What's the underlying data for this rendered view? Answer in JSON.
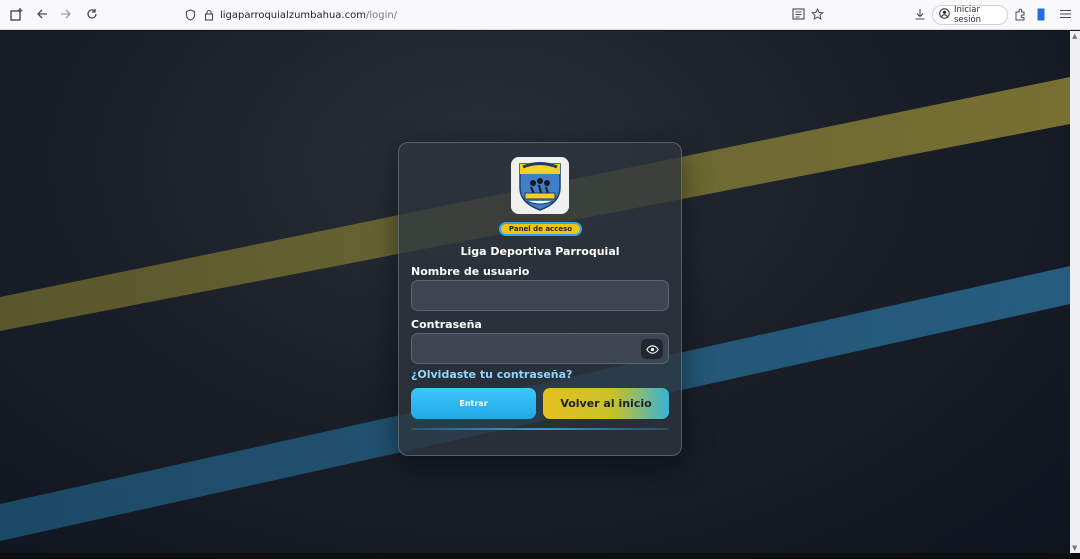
{
  "browser": {
    "url_host": "ligaparroquialzumbahua.com",
    "url_path": "/login/",
    "signin_label": "Iniciar sesión"
  },
  "icons": {
    "new_tab": "new-tab-icon",
    "back": "back-arrow-icon",
    "forward": "forward-arrow-icon",
    "reload": "reload-icon",
    "shield": "shield-icon",
    "lock": "lock-icon",
    "reader": "reader-view-icon",
    "bookmark": "star-icon",
    "download": "download-icon",
    "account": "account-icon",
    "extensions": "extensions-icon",
    "menu": "hamburger-menu-icon",
    "eye": "eye-icon"
  },
  "login": {
    "badge": "Panel de acceso",
    "title": "Liga Deportiva Parroquial",
    "username_label": "Nombre de usuario",
    "username_value": "",
    "password_label": "Contraseña",
    "password_value": "",
    "forgot_link": "¿Olvidaste tu contraseña?",
    "enter_button": "Entrar",
    "home_button": "Volver al inicio"
  },
  "colors": {
    "badge_bg": "#f1c40f",
    "enter_button": "#2bb4ef",
    "link": "#8fd6ff",
    "background": "#141b26"
  }
}
